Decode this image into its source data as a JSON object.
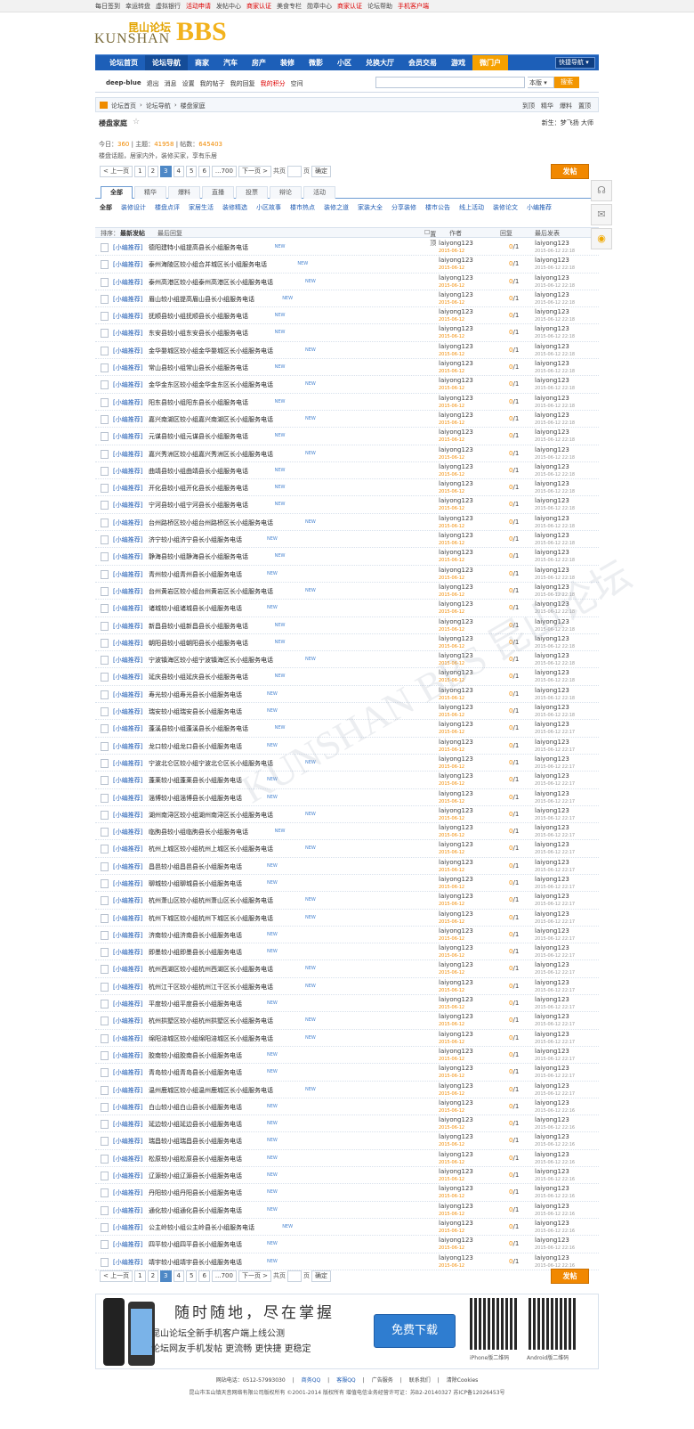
{
  "topbar": {
    "links": [
      {
        "label": "每日签到",
        "red": false
      },
      {
        "label": "幸运转盘",
        "red": false
      },
      {
        "label": "虚拟银行",
        "red": false
      },
      {
        "label": "活动申请",
        "red": true
      },
      {
        "label": "发帖中心",
        "red": false
      },
      {
        "label": "商家认证",
        "red": true
      },
      {
        "label": "美食专栏",
        "red": false
      },
      {
        "label": "勋章中心",
        "red": false
      },
      {
        "label": "商家认证",
        "red": true
      },
      {
        "label": "论坛帮助",
        "red": false
      },
      {
        "label": "手机客户端",
        "red": true
      }
    ]
  },
  "logo": {
    "en": "KUNSHAN",
    "cn": "昆山论坛",
    "bbs": "BBS"
  },
  "nav": {
    "items": [
      {
        "label": "论坛首页",
        "style": ""
      },
      {
        "label": "论坛导航",
        "style": "active"
      },
      {
        "label": "商家",
        "style": ""
      },
      {
        "label": "汽车",
        "style": ""
      },
      {
        "label": "房产",
        "style": ""
      },
      {
        "label": "装修",
        "style": ""
      },
      {
        "label": "微影",
        "style": ""
      },
      {
        "label": "小区",
        "style": ""
      },
      {
        "label": "兑换大厅",
        "style": ""
      },
      {
        "label": "会员交易",
        "style": ""
      },
      {
        "label": "游戏",
        "style": ""
      },
      {
        "label": "微门户",
        "style": "micro"
      }
    ],
    "select": "快捷导航"
  },
  "toolbar": {
    "links": [
      {
        "label": "deep-blue",
        "style": "b"
      },
      {
        "label": "退出",
        "style": ""
      },
      {
        "label": "消息",
        "style": ""
      },
      {
        "label": "设置",
        "style": ""
      },
      {
        "label": "我的帖子",
        "style": ""
      },
      {
        "label": "我的回复",
        "style": ""
      },
      {
        "label": "我的积分",
        "style": "r"
      },
      {
        "label": "空间",
        "style": ""
      }
    ],
    "search_scope": "本版",
    "search_button": "搜索"
  },
  "breadcrumb": {
    "items": [
      "论坛首页",
      "论坛导航",
      "楼盘家庭"
    ],
    "right": [
      "到顶",
      "精华",
      "爆料",
      "置顶"
    ]
  },
  "forum": {
    "name": "楼盘家庭",
    "newest": "新生：梦飞扬 大师",
    "stats_label_today": "今日：",
    "today": "360",
    "stats_label_topics": "主题：",
    "topics": "41958",
    "stats_label_posts": "帖数：",
    "posts": "645403",
    "description": "楼盘话题，居家内外，装修买家，享有乐居"
  },
  "pager": {
    "prev": "< 上一页",
    "pages": [
      "1",
      "2",
      "3",
      "4",
      "5",
      "6",
      "...700"
    ],
    "current": "3",
    "next": "下一页 >",
    "total_label": "页",
    "go": "确定",
    "page_label": "共页"
  },
  "post_button": "发帖",
  "tabs": [
    {
      "label": "全部",
      "active": true
    },
    {
      "label": "精华",
      "active": false
    },
    {
      "label": "爆料",
      "active": false
    },
    {
      "label": "直播",
      "active": false
    },
    {
      "label": "投票",
      "active": false
    },
    {
      "label": "辩论",
      "active": false
    },
    {
      "label": "活动",
      "active": false
    }
  ],
  "categories": [
    "全部",
    "装修设计",
    "楼盘点评",
    "家居生活",
    "装修精选",
    "小区故事",
    "楼市热点",
    "装修之道",
    "家装大全",
    "分享装修",
    "楼市公告",
    "线上活动",
    "装修论文",
    "小编推荐"
  ],
  "thead": {
    "sort": "排序：",
    "sort_hot": "最新发帖",
    "sort_reply": "最后回复",
    "top": "置顶",
    "author": "作者",
    "reply": "回复",
    "last": "最后发表"
  },
  "threads": [
    {
      "tag": "[小编推荐]",
      "title": "德阳建特小组提高县长小组服务电话",
      "author": "laiyong123",
      "date": "2015-06-12",
      "replies": "0",
      "views": "1",
      "last": "laiyong123",
      "lastdate": "2015-06-12 22:18"
    },
    {
      "tag": "[小编推荐]",
      "title": "泰州海陵区较小组合并城区长小组服务电话",
      "author": "laiyong123",
      "date": "2015-06-12",
      "replies": "0",
      "views": "1",
      "last": "laiyong123",
      "lastdate": "2015-06-12 22:18"
    },
    {
      "tag": "[小编推荐]",
      "title": "泰州高港区较小组泰州高港区长小组服务电话",
      "author": "laiyong123",
      "date": "2015-06-12",
      "replies": "0",
      "views": "1",
      "last": "laiyong123",
      "lastdate": "2015-06-12 22:18"
    },
    {
      "tag": "[小编推荐]",
      "title": "眉山较小组提高眉山县长小组服务电话",
      "author": "laiyong123",
      "date": "2015-06-12",
      "replies": "0",
      "views": "1",
      "last": "laiyong123",
      "lastdate": "2015-06-12 22:18"
    },
    {
      "tag": "[小编推荐]",
      "title": "抚顺县较小组抚顺县长小组服务电话",
      "author": "laiyong123",
      "date": "2015-06-12",
      "replies": "0",
      "views": "1",
      "last": "laiyong123",
      "lastdate": "2015-06-12 22:18"
    },
    {
      "tag": "[小编推荐]",
      "title": "东安县较小组东安县长小组服务电话",
      "author": "laiyong123",
      "date": "2015-06-12",
      "replies": "0",
      "views": "1",
      "last": "laiyong123",
      "lastdate": "2015-06-12 22:18"
    },
    {
      "tag": "[小编推荐]",
      "title": "金华婺城区较小组金华婺城区长小组服务电话",
      "author": "laiyong123",
      "date": "2015-06-12",
      "replies": "0",
      "views": "1",
      "last": "laiyong123",
      "lastdate": "2015-06-12 22:18"
    },
    {
      "tag": "[小编推荐]",
      "title": "常山县较小组常山县长小组服务电话",
      "author": "laiyong123",
      "date": "2015-06-12",
      "replies": "0",
      "views": "1",
      "last": "laiyong123",
      "lastdate": "2015-06-12 22:18"
    },
    {
      "tag": "[小编推荐]",
      "title": "金华金东区较小组金华金东区长小组服务电话",
      "author": "laiyong123",
      "date": "2015-06-12",
      "replies": "0",
      "views": "1",
      "last": "laiyong123",
      "lastdate": "2015-06-12 22:18"
    },
    {
      "tag": "[小编推荐]",
      "title": "阳东县较小组阳东县长小组服务电话",
      "author": "laiyong123",
      "date": "2015-06-12",
      "replies": "0",
      "views": "1",
      "last": "laiyong123",
      "lastdate": "2015-06-12 22:18"
    },
    {
      "tag": "[小编推荐]",
      "title": "嘉兴南湖区较小组嘉兴南湖区长小组服务电话",
      "author": "laiyong123",
      "date": "2015-06-12",
      "replies": "0",
      "views": "1",
      "last": "laiyong123",
      "lastdate": "2015-06-12 22:18"
    },
    {
      "tag": "[小编推荐]",
      "title": "元谋县较小组元谋县长小组服务电话",
      "author": "laiyong123",
      "date": "2015-06-12",
      "replies": "0",
      "views": "1",
      "last": "laiyong123",
      "lastdate": "2015-06-12 22:18"
    },
    {
      "tag": "[小编推荐]",
      "title": "嘉兴秀洲区较小组嘉兴秀洲区长小组服务电话",
      "author": "laiyong123",
      "date": "2015-06-12",
      "replies": "0",
      "views": "1",
      "last": "laiyong123",
      "lastdate": "2015-06-12 22:18"
    },
    {
      "tag": "[小编推荐]",
      "title": "曲靖县较小组曲靖县长小组服务电话",
      "author": "laiyong123",
      "date": "2015-06-12",
      "replies": "0",
      "views": "1",
      "last": "laiyong123",
      "lastdate": "2015-06-12 22:18"
    },
    {
      "tag": "[小编推荐]",
      "title": "开化县较小组开化县长小组服务电话",
      "author": "laiyong123",
      "date": "2015-06-12",
      "replies": "0",
      "views": "1",
      "last": "laiyong123",
      "lastdate": "2015-06-12 22:18"
    },
    {
      "tag": "[小编推荐]",
      "title": "宁河县较小组宁河县长小组服务电话",
      "author": "laiyong123",
      "date": "2015-06-12",
      "replies": "0",
      "views": "1",
      "last": "laiyong123",
      "lastdate": "2015-06-12 22:18"
    },
    {
      "tag": "[小编推荐]",
      "title": "台州路桥区较小组台州路桥区长小组服务电话",
      "author": "laiyong123",
      "date": "2015-06-12",
      "replies": "0",
      "views": "1",
      "last": "laiyong123",
      "lastdate": "2015-06-12 22:18"
    },
    {
      "tag": "[小编推荐]",
      "title": "济宁较小组济宁县长小组服务电话",
      "author": "laiyong123",
      "date": "2015-06-12",
      "replies": "0",
      "views": "1",
      "last": "laiyong123",
      "lastdate": "2015-06-12 22:18"
    },
    {
      "tag": "[小编推荐]",
      "title": "静海县较小组静海县长小组服务电话",
      "author": "laiyong123",
      "date": "2015-06-12",
      "replies": "0",
      "views": "1",
      "last": "laiyong123",
      "lastdate": "2015-06-12 22:18"
    },
    {
      "tag": "[小编推荐]",
      "title": "青州较小组青州县长小组服务电话",
      "author": "laiyong123",
      "date": "2015-06-12",
      "replies": "0",
      "views": "1",
      "last": "laiyong123",
      "lastdate": "2015-06-12 22:18"
    },
    {
      "tag": "[小编推荐]",
      "title": "台州黄岩区较小组台州黄岩区长小组服务电话",
      "author": "laiyong123",
      "date": "2015-06-12",
      "replies": "0",
      "views": "1",
      "last": "laiyong123",
      "lastdate": "2015-06-12 22:18"
    },
    {
      "tag": "[小编推荐]",
      "title": "诸城较小组诸城县长小组服务电话",
      "author": "laiyong123",
      "date": "2015-06-12",
      "replies": "0",
      "views": "1",
      "last": "laiyong123",
      "lastdate": "2015-06-12 22:18"
    },
    {
      "tag": "[小编推荐]",
      "title": "新昌县较小组新昌县长小组服务电话",
      "author": "laiyong123",
      "date": "2015-06-12",
      "replies": "0",
      "views": "1",
      "last": "laiyong123",
      "lastdate": "2015-06-12 22:18"
    },
    {
      "tag": "[小编推荐]",
      "title": "朝阳县较小组朝阳县长小组服务电话",
      "author": "laiyong123",
      "date": "2015-06-12",
      "replies": "0",
      "views": "1",
      "last": "laiyong123",
      "lastdate": "2015-06-12 22:18"
    },
    {
      "tag": "[小编推荐]",
      "title": "宁波镇海区较小组宁波镇海区长小组服务电话",
      "author": "laiyong123",
      "date": "2015-06-12",
      "replies": "0",
      "views": "1",
      "last": "laiyong123",
      "lastdate": "2015-06-12 22:18"
    },
    {
      "tag": "[小编推荐]",
      "title": "延庆县较小组延庆县长小组服务电话",
      "author": "laiyong123",
      "date": "2015-06-12",
      "replies": "0",
      "views": "1",
      "last": "laiyong123",
      "lastdate": "2015-06-12 22:18"
    },
    {
      "tag": "[小编推荐]",
      "title": "寿光较小组寿光县长小组服务电话",
      "author": "laiyong123",
      "date": "2015-06-12",
      "replies": "0",
      "views": "1",
      "last": "laiyong123",
      "lastdate": "2015-06-12 22:18"
    },
    {
      "tag": "[小编推荐]",
      "title": "瑞安较小组瑞安县长小组服务电话",
      "author": "laiyong123",
      "date": "2015-06-12",
      "replies": "0",
      "views": "1",
      "last": "laiyong123",
      "lastdate": "2015-06-12 22:18"
    },
    {
      "tag": "[小编推荐]",
      "title": "蓬溪县较小组蓬溪县长小组服务电话",
      "author": "laiyong123",
      "date": "2015-06-12",
      "replies": "0",
      "views": "1",
      "last": "laiyong123",
      "lastdate": "2015-06-12 22:17"
    },
    {
      "tag": "[小编推荐]",
      "title": "龙口较小组龙口县长小组服务电话",
      "author": "laiyong123",
      "date": "2015-06-12",
      "replies": "0",
      "views": "1",
      "last": "laiyong123",
      "lastdate": "2015-06-12 22:17"
    },
    {
      "tag": "[小编推荐]",
      "title": "宁波北仑区较小组宁波北仑区长小组服务电话",
      "author": "laiyong123",
      "date": "2015-06-12",
      "replies": "0",
      "views": "1",
      "last": "laiyong123",
      "lastdate": "2015-06-12 22:17"
    },
    {
      "tag": "[小编推荐]",
      "title": "蓬莱较小组蓬莱县长小组服务电话",
      "author": "laiyong123",
      "date": "2015-06-12",
      "replies": "0",
      "views": "1",
      "last": "laiyong123",
      "lastdate": "2015-06-12 22:17"
    },
    {
      "tag": "[小编推荐]",
      "title": "淄博较小组淄博县长小组服务电话",
      "author": "laiyong123",
      "date": "2015-06-12",
      "replies": "0",
      "views": "1",
      "last": "laiyong123",
      "lastdate": "2015-06-12 22:17"
    },
    {
      "tag": "[小编推荐]",
      "title": "湖州南浔区较小组湖州南浔区长小组服务电话",
      "author": "laiyong123",
      "date": "2015-06-12",
      "replies": "0",
      "views": "1",
      "last": "laiyong123",
      "lastdate": "2015-06-12 22:17"
    },
    {
      "tag": "[小编推荐]",
      "title": "临朐县较小组临朐县长小组服务电话",
      "author": "laiyong123",
      "date": "2015-06-12",
      "replies": "0",
      "views": "1",
      "last": "laiyong123",
      "lastdate": "2015-06-12 22:17"
    },
    {
      "tag": "[小编推荐]",
      "title": "杭州上城区较小组杭州上城区长小组服务电话",
      "author": "laiyong123",
      "date": "2015-06-12",
      "replies": "0",
      "views": "1",
      "last": "laiyong123",
      "lastdate": "2015-06-12 22:17"
    },
    {
      "tag": "[小编推荐]",
      "title": "昌邑较小组昌邑县长小组服务电话",
      "author": "laiyong123",
      "date": "2015-06-12",
      "replies": "0",
      "views": "1",
      "last": "laiyong123",
      "lastdate": "2015-06-12 22:17"
    },
    {
      "tag": "[小编推荐]",
      "title": "聊城较小组聊城县长小组服务电话",
      "author": "laiyong123",
      "date": "2015-06-12",
      "replies": "0",
      "views": "1",
      "last": "laiyong123",
      "lastdate": "2015-06-12 22:17"
    },
    {
      "tag": "[小编推荐]",
      "title": "杭州萧山区较小组杭州萧山区长小组服务电话",
      "author": "laiyong123",
      "date": "2015-06-12",
      "replies": "0",
      "views": "1",
      "last": "laiyong123",
      "lastdate": "2015-06-12 22:17"
    },
    {
      "tag": "[小编推荐]",
      "title": "杭州下城区较小组杭州下城区长小组服务电话",
      "author": "laiyong123",
      "date": "2015-06-12",
      "replies": "0",
      "views": "1",
      "last": "laiyong123",
      "lastdate": "2015-06-12 22:17"
    },
    {
      "tag": "[小编推荐]",
      "title": "济南较小组济南县长小组服务电话",
      "author": "laiyong123",
      "date": "2015-06-12",
      "replies": "0",
      "views": "1",
      "last": "laiyong123",
      "lastdate": "2015-06-12 22:17"
    },
    {
      "tag": "[小编推荐]",
      "title": "即墨较小组即墨县长小组服务电话",
      "author": "laiyong123",
      "date": "2015-06-12",
      "replies": "0",
      "views": "1",
      "last": "laiyong123",
      "lastdate": "2015-06-12 22:17"
    },
    {
      "tag": "[小编推荐]",
      "title": "杭州西湖区较小组杭州西湖区长小组服务电话",
      "author": "laiyong123",
      "date": "2015-06-12",
      "replies": "0",
      "views": "1",
      "last": "laiyong123",
      "lastdate": "2015-06-12 22:17"
    },
    {
      "tag": "[小编推荐]",
      "title": "杭州江干区较小组杭州江干区长小组服务电话",
      "author": "laiyong123",
      "date": "2015-06-12",
      "replies": "0",
      "views": "1",
      "last": "laiyong123",
      "lastdate": "2015-06-12 22:17"
    },
    {
      "tag": "[小编推荐]",
      "title": "平度较小组平度县长小组服务电话",
      "author": "laiyong123",
      "date": "2015-06-12",
      "replies": "0",
      "views": "1",
      "last": "laiyong123",
      "lastdate": "2015-06-12 22:17"
    },
    {
      "tag": "[小编推荐]",
      "title": "杭州拱墅区较小组杭州拱墅区长小组服务电话",
      "author": "laiyong123",
      "date": "2015-06-12",
      "replies": "0",
      "views": "1",
      "last": "laiyong123",
      "lastdate": "2015-06-12 22:17"
    },
    {
      "tag": "[小编推荐]",
      "title": "绵阳涪城区较小组绵阳涪城区长小组服务电话",
      "author": "laiyong123",
      "date": "2015-06-12",
      "replies": "0",
      "views": "1",
      "last": "laiyong123",
      "lastdate": "2015-06-12 22:17"
    },
    {
      "tag": "[小编推荐]",
      "title": "胶南较小组胶南县长小组服务电话",
      "author": "laiyong123",
      "date": "2015-06-12",
      "replies": "0",
      "views": "1",
      "last": "laiyong123",
      "lastdate": "2015-06-12 22:17"
    },
    {
      "tag": "[小编推荐]",
      "title": "青岛较小组青岛县长小组服务电话",
      "author": "laiyong123",
      "date": "2015-06-12",
      "replies": "0",
      "views": "1",
      "last": "laiyong123",
      "lastdate": "2015-06-12 22:17"
    },
    {
      "tag": "[小编推荐]",
      "title": "温州鹿城区较小组温州鹿城区长小组服务电话",
      "author": "laiyong123",
      "date": "2015-06-12",
      "replies": "0",
      "views": "1",
      "last": "laiyong123",
      "lastdate": "2015-06-12 22:17"
    },
    {
      "tag": "[小编推荐]",
      "title": "白山较小组白山县长小组服务电话",
      "author": "laiyong123",
      "date": "2015-06-12",
      "replies": "0",
      "views": "1",
      "last": "laiyong123",
      "lastdate": "2015-06-12 22:16"
    },
    {
      "tag": "[小编推荐]",
      "title": "延边较小组延边县长小组服务电话",
      "author": "laiyong123",
      "date": "2015-06-12",
      "replies": "0",
      "views": "1",
      "last": "laiyong123",
      "lastdate": "2015-06-12 22:16"
    },
    {
      "tag": "[小编推荐]",
      "title": "瑞昌较小组瑞昌县长小组服务电话",
      "author": "laiyong123",
      "date": "2015-06-12",
      "replies": "0",
      "views": "1",
      "last": "laiyong123",
      "lastdate": "2015-06-12 22:16"
    },
    {
      "tag": "[小编推荐]",
      "title": "松原较小组松原县长小组服务电话",
      "author": "laiyong123",
      "date": "2015-06-12",
      "replies": "0",
      "views": "1",
      "last": "laiyong123",
      "lastdate": "2015-06-12 22:16"
    },
    {
      "tag": "[小编推荐]",
      "title": "辽源较小组辽源县长小组服务电话",
      "author": "laiyong123",
      "date": "2015-06-12",
      "replies": "0",
      "views": "1",
      "last": "laiyong123",
      "lastdate": "2015-06-12 22:16"
    },
    {
      "tag": "[小编推荐]",
      "title": "丹阳较小组丹阳县长小组服务电话",
      "author": "laiyong123",
      "date": "2015-06-12",
      "replies": "0",
      "views": "1",
      "last": "laiyong123",
      "lastdate": "2015-06-12 22:16"
    },
    {
      "tag": "[小编推荐]",
      "title": "通化较小组通化县长小组服务电话",
      "author": "laiyong123",
      "date": "2015-06-12",
      "replies": "0",
      "views": "1",
      "last": "laiyong123",
      "lastdate": "2015-06-12 22:16"
    },
    {
      "tag": "[小编推荐]",
      "title": "公主岭较小组公主岭县长小组服务电话",
      "author": "laiyong123",
      "date": "2015-06-12",
      "replies": "0",
      "views": "1",
      "last": "laiyong123",
      "lastdate": "2015-06-12 22:16"
    },
    {
      "tag": "[小编推荐]",
      "title": "四平较小组四平县长小组服务电话",
      "author": "laiyong123",
      "date": "2015-06-12",
      "replies": "0",
      "views": "1",
      "last": "laiyong123",
      "lastdate": "2015-06-12 22:16"
    },
    {
      "tag": "[小编推荐]",
      "title": "靖宇较小组靖宇县长小组服务电话",
      "author": "laiyong123",
      "date": "2015-06-12",
      "replies": "0",
      "views": "1",
      "last": "laiyong123",
      "lastdate": "2015-06-12 22:16"
    }
  ],
  "new_badge": "NEW",
  "watermark": "KUNSHAN BBS 昆山论坛",
  "app": {
    "slogan": "随时随地，尽在掌握",
    "line1": "昆山论坛全新手机客户端上线公测",
    "line2": "论坛网友手机发帖 更流畅 更快捷 更稳定",
    "download": "免费下载",
    "qr1": "iPhone版二维码",
    "qr2": "Android版二维码"
  },
  "footer": {
    "links": [
      {
        "label": "网站电话：0512-57993030",
        "b": false
      },
      {
        "label": "商务QQ",
        "b": true
      },
      {
        "label": "客服QQ",
        "b": true
      },
      {
        "label": "广告服务",
        "b": false
      },
      {
        "label": "联系我们",
        "b": false
      },
      {
        "label": "清除Cookies",
        "b": false
      }
    ],
    "copyright": "昆山市玉山镇天音网络有限公司版权所有 ©2001-2014 版权所有 增值电信业务经营许可证：苏B2-20140327 苏ICP备12026453号"
  }
}
